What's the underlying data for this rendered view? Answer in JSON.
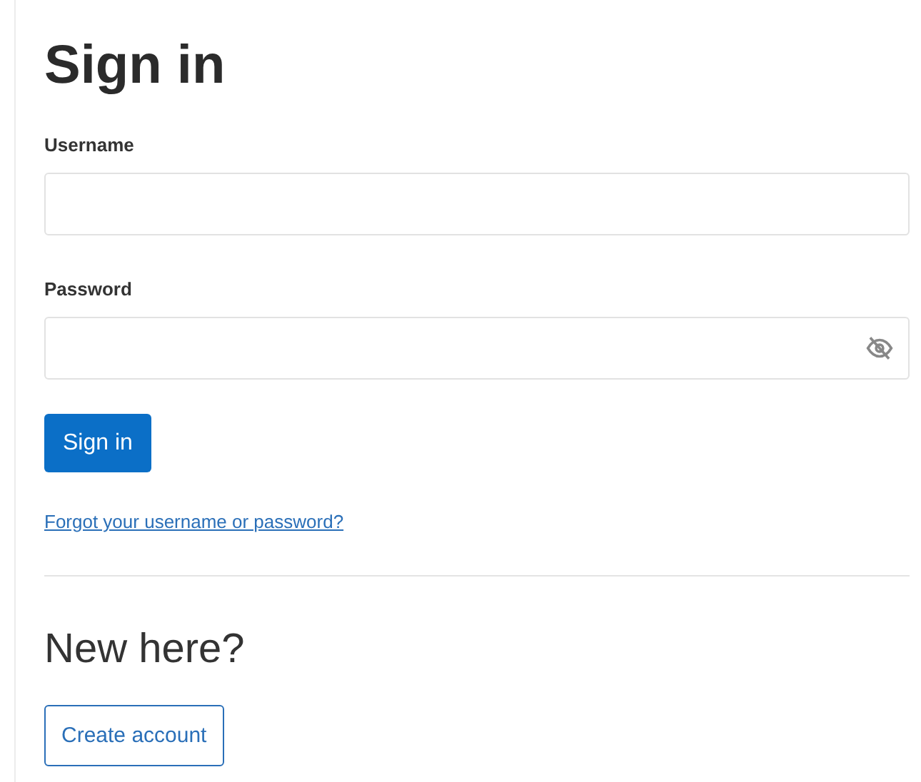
{
  "title": "Sign in",
  "fields": [
    {
      "label": "Username",
      "kind": "text"
    },
    {
      "label": "Password",
      "kind": "password"
    }
  ],
  "submit": "Sign in",
  "forgot_link": "Forgot your username or password?",
  "new_heading": "New here?",
  "create_button": "Create account"
}
